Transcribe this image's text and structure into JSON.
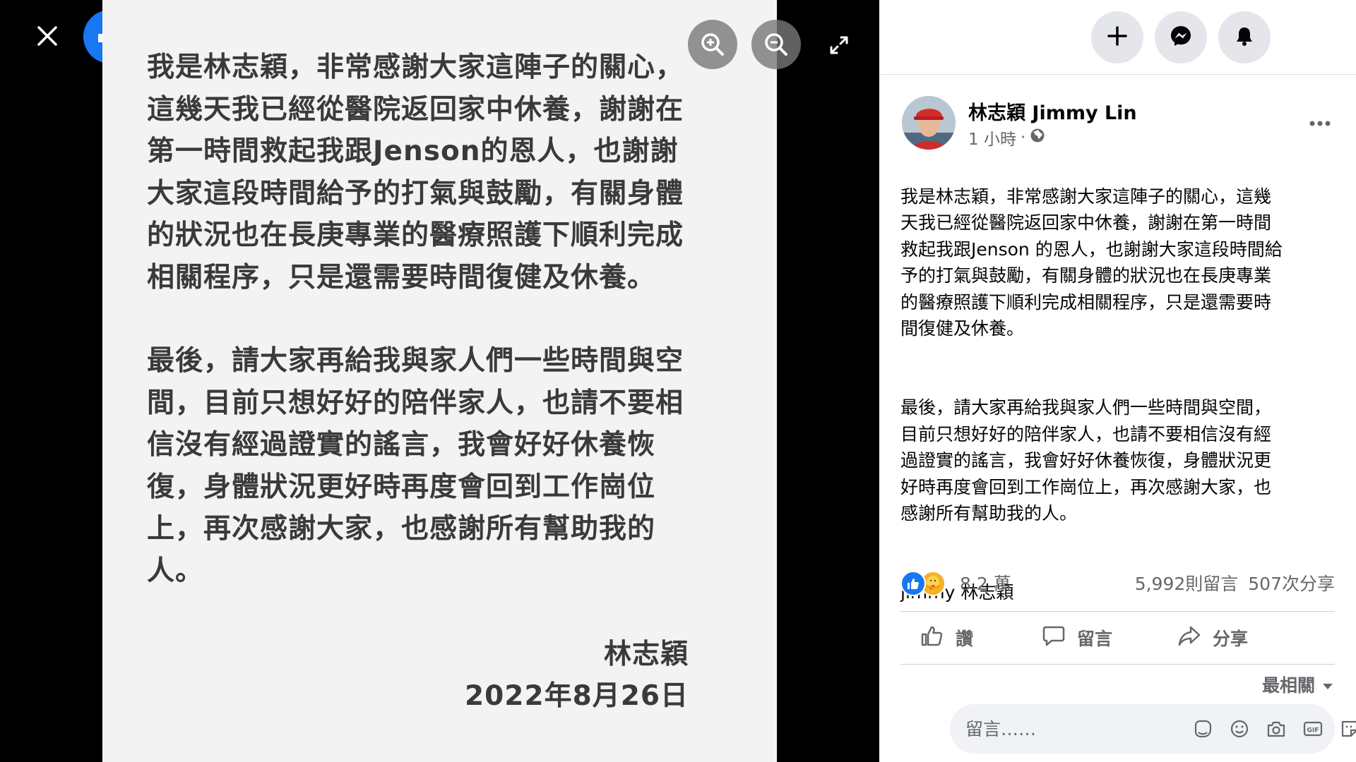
{
  "viewer": {
    "photo_text": {
      "paragraph_1": "我是林志穎，非常感謝大家這陣子的關心，\n這幾天我已經從醫院返回家中休養，謝謝在\n第一時間救起我跟Jenson的恩人，也謝謝\n大家這段時間給予的打氣與鼓勵，有關身體\n的狀況也在長庚專業的醫療照護下順利完成\n相關程序，只是還需要時間復健及休養。",
      "paragraph_2": "最後，請大家再給我與家人們一些時間與空\n間，目前只想好好的陪伴家人，也請不要相\n信沒有經過證實的謠言，我會好好休養恢\n復，身體狀況更好時再度會回到工作崗位\n上，再次感謝大家，也感謝所有幫助我的\n人。",
      "signature_name": "林志穎",
      "signature_date": "2022年8月26日"
    },
    "icons": {
      "close": "close-icon",
      "logo": "facebook-logo",
      "zoom_in": "zoom-in-icon",
      "zoom_out": "zoom-out-icon",
      "fullscreen": "expand-icon"
    }
  },
  "topbar": {
    "icons": [
      "plus-icon",
      "messenger-icon",
      "bell-icon"
    ]
  },
  "post": {
    "author": "林志穎 Jimmy Lin",
    "time": "1 小時",
    "separator": "·",
    "paragraphs": [
      "我是林志穎，非常感謝大家這陣子的關心，這幾\n天我已經從醫院返回家中休養，謝謝在第一時間\n救起我跟Jenson 的恩人，也謝謝大家這段時間給\n予的打氣與鼓勵，有關身體的狀況也在長庚專業\n的醫療照護下順利完成相關程序，只是還需要時\n間復健及休養。",
      "最後，請大家再給我與家人們一些時間與空間，\n目前只想好好的陪伴家人，也請不要相信沒有經\n過證實的謠言，我會好好休養恢復，身體狀況更\n好時再度會回到工作崗位上，再次感謝大家，也\n感謝所有幫助我的人。",
      "jimmy 林志穎"
    ]
  },
  "stats": {
    "reactions": "8.2 萬",
    "comments": "5,992則留言",
    "shares": "507次分享"
  },
  "actions": {
    "like": "讚",
    "comment": "留言",
    "share": "分享"
  },
  "sort": {
    "label": "最相關"
  },
  "comment_box": {
    "placeholder": "留言……",
    "tools": [
      "sticker-face-icon",
      "emoji-icon",
      "camera-icon",
      "gif-icon",
      "sticker-icon"
    ]
  },
  "colors": {
    "facebook_blue": "#1877f2",
    "secondary_text": "#65676b",
    "photo_text": "#3a3a3a",
    "care_yellow": "#f7b125"
  }
}
